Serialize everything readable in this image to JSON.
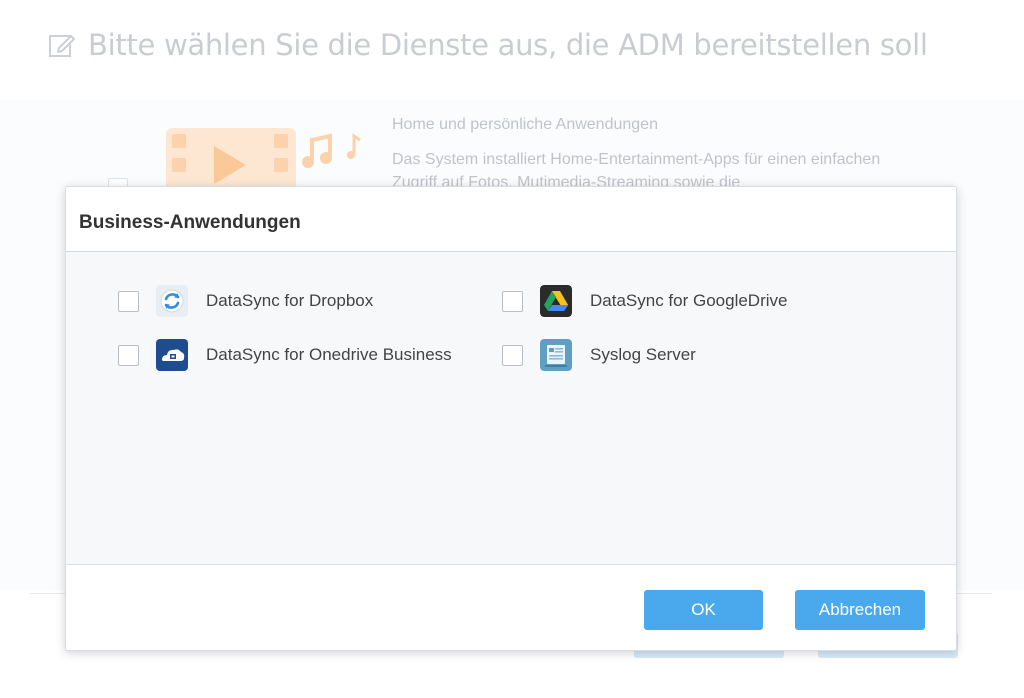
{
  "background": {
    "title": "Bitte wählen Sie die Dienste aus, die ADM bereitstellen soll",
    "section_title": "Home und persönliche Anwendungen",
    "section_description": "Das System installiert Home-Entertainment-Apps für einen einfachen Zugriff auf Fotos, Mutimedia-Streaming sowie die"
  },
  "dialog": {
    "title": "Business-Anwendungen",
    "services": [
      {
        "label": "DataSync for Dropbox",
        "icon": "dropbox-sync-icon",
        "checked": false
      },
      {
        "label": "DataSync for GoogleDrive",
        "icon": "google-drive-icon",
        "checked": false
      },
      {
        "label": "DataSync for Onedrive Business",
        "icon": "onedrive-icon",
        "checked": false
      },
      {
        "label": "Syslog Server",
        "icon": "syslog-server-icon",
        "checked": false
      }
    ],
    "ok_label": "OK",
    "cancel_label": "Abbrechen"
  },
  "colors": {
    "accent": "#4aa8ec",
    "dialog_body": "#f7f8fa",
    "onedrive_blue": "#1f4b8f"
  }
}
